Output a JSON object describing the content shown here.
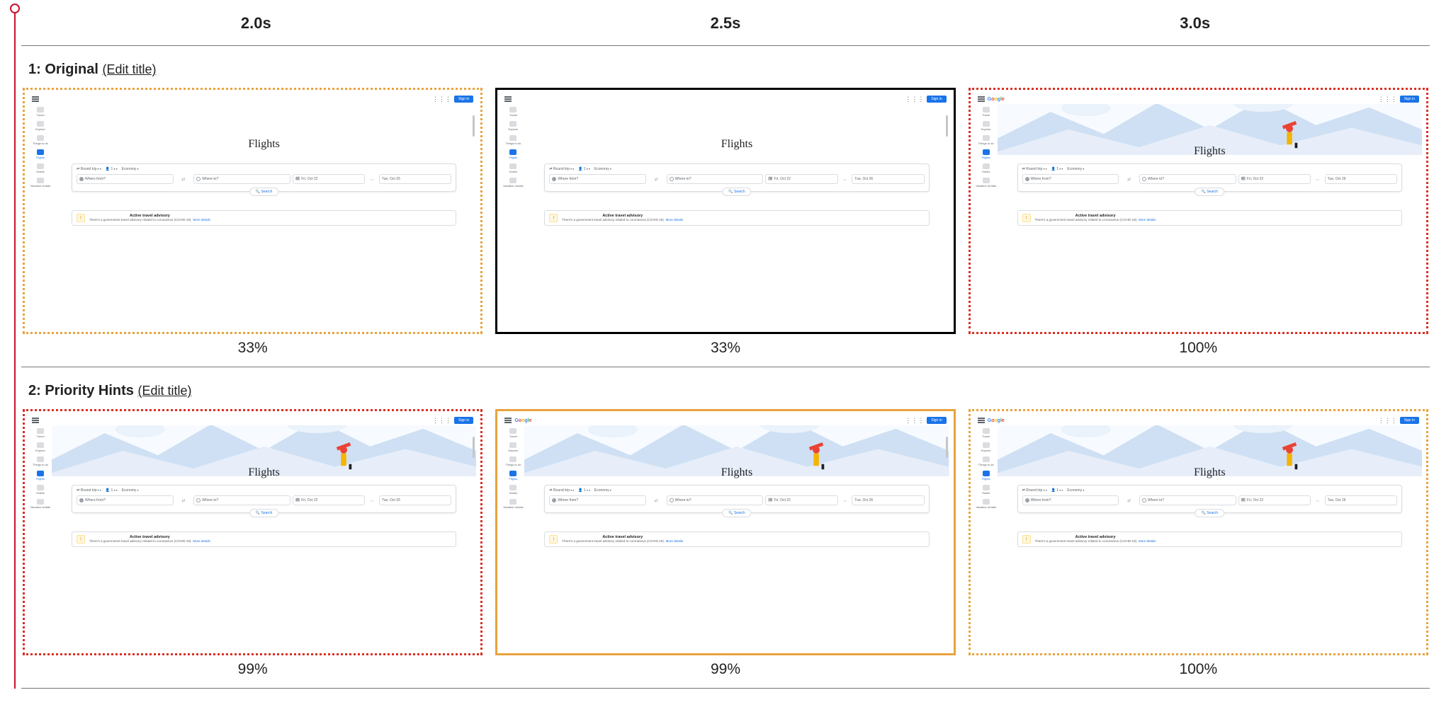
{
  "times": [
    "2.0s",
    "2.5s",
    "3.0s"
  ],
  "runs": [
    {
      "index": "1",
      "title": "Original",
      "edit_label": "(Edit title)",
      "frames": [
        {
          "pct": "33%",
          "border": "b-dotted-orange",
          "left_bracket": true,
          "has_hero": false,
          "has_logo": false,
          "show_scrollbar": true
        },
        {
          "pct": "33%",
          "border": "b-solid-black",
          "left_bracket": false,
          "has_hero": false,
          "has_logo": false,
          "show_scrollbar": true
        },
        {
          "pct": "100%",
          "border": "b-dotted-red",
          "left_bracket": false,
          "has_hero": true,
          "has_logo": true,
          "show_scrollbar": false
        }
      ]
    },
    {
      "index": "2",
      "title": "Priority Hints",
      "edit_label": "(Edit title)",
      "frames": [
        {
          "pct": "99%",
          "border": "b-dotted-red",
          "left_bracket": true,
          "has_hero": true,
          "has_logo": false,
          "show_scrollbar": true
        },
        {
          "pct": "99%",
          "border": "b-solid-orange",
          "left_bracket": false,
          "has_hero": true,
          "has_logo": true,
          "show_scrollbar": true
        },
        {
          "pct": "100%",
          "border": "b-dotted-orange",
          "left_bracket": false,
          "has_hero": true,
          "has_logo": true,
          "show_scrollbar": false
        }
      ]
    }
  ],
  "shot": {
    "logo_chars": [
      "G",
      "o",
      "o",
      "g",
      "l",
      "e"
    ],
    "signin": "Sign in",
    "nav": [
      {
        "icon": "nv",
        "label": "Travel",
        "active": false
      },
      {
        "icon": "nv",
        "label": "Explore",
        "active": false
      },
      {
        "icon": "nv",
        "label": "Things to do",
        "active": false
      },
      {
        "icon": "nv",
        "label": "Flights",
        "active": true
      },
      {
        "icon": "nv",
        "label": "Hotels",
        "active": false
      },
      {
        "icon": "nv",
        "label": "Vacation rentals",
        "active": false
      }
    ],
    "headline": "Flights",
    "chips": [
      "Round trip",
      "1",
      "Economy"
    ],
    "where_from": "Where from?",
    "where_to": "Where to?",
    "date1": "Fri, Oct 22",
    "date2": "Tue, Oct 26",
    "search_btn": "Search",
    "advisory_title": "Active travel advisory",
    "advisory_body": "There's a government travel advisory related to coronavirus (COVID-19).",
    "advisory_link": "More details"
  }
}
